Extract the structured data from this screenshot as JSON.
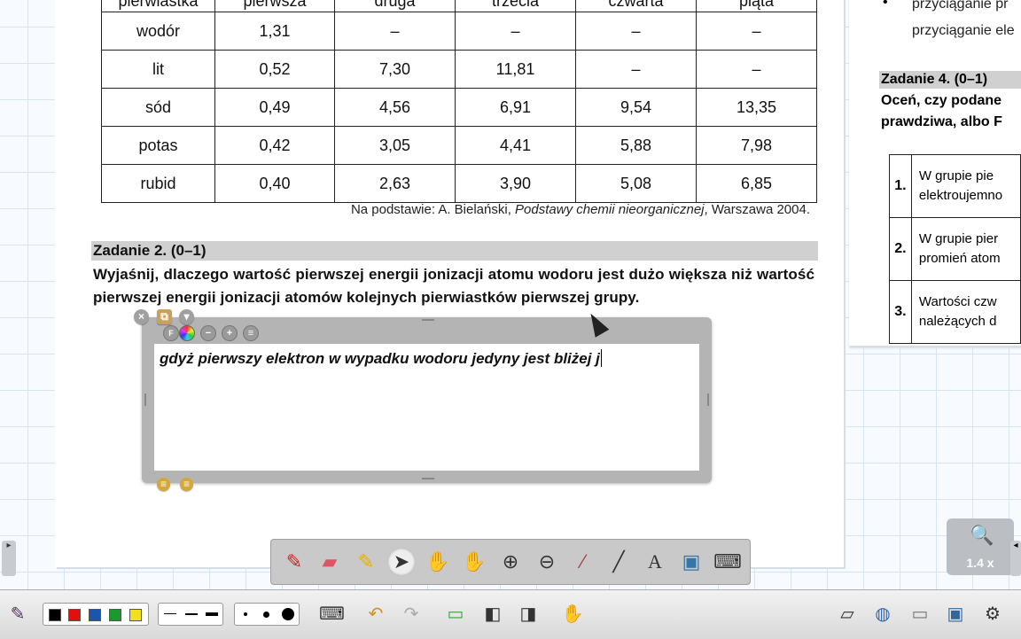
{
  "table": {
    "headers": [
      "pierwiastka",
      "pierwsza",
      "druga",
      "trzecia",
      "czwarta",
      "piąta"
    ],
    "rows": [
      [
        "wodór",
        "1,31",
        "–",
        "–",
        "–",
        "–"
      ],
      [
        "lit",
        "0,52",
        "7,30",
        "11,81",
        "–",
        "–"
      ],
      [
        "sód",
        "0,49",
        "4,56",
        "6,91",
        "9,54",
        "13,35"
      ],
      [
        "potas",
        "0,42",
        "3,05",
        "4,41",
        "5,88",
        "7,98"
      ],
      [
        "rubid",
        "0,40",
        "2,63",
        "3,90",
        "5,08",
        "6,85"
      ]
    ],
    "source_prefix": "Na podstawie: A. Bielański, ",
    "source_title": "Podstawy chemii nieorganicznej",
    "source_suffix": ", Warszawa 2004."
  },
  "task2": {
    "title": "Zadanie 2. (0–1)",
    "question": "Wyjaśnij, dlaczego wartość pierwszej energii jonizacji atomu wodoru jest dużo większa niż wartość pierwszej energii jonizacji atomów kolejnych pierwiastków pierwszej grupy."
  },
  "textbox": {
    "content": "gdyż pierwszy elektron w wypadku wodoru jedyny jest bliżej j",
    "icons": [
      "close-icon",
      "clone-icon",
      "menu-dropdown-icon",
      "font-icon",
      "color-icon",
      "decrease-icon",
      "increase-icon",
      "format-icon"
    ]
  },
  "right_page": {
    "bullet": "•",
    "line1": "przyciąganie pr",
    "line2": "przyciąganie ele",
    "task4_title": "Zadanie 4. (0–1)",
    "bold1": "Oceń, czy podane",
    "bold2": "prawdziwa, albo F",
    "rows": [
      {
        "num": "1.",
        "l1": "W grupie pie",
        "l2": "elektroujemno"
      },
      {
        "num": "2.",
        "l1": "W grupie pier",
        "l2": "promień atom"
      },
      {
        "num": "3.",
        "l1": "Wartości czw",
        "l2": "należących d"
      }
    ]
  },
  "float_toolbar": {
    "tools": [
      "pen-icon",
      "eraser-icon",
      "highlighter-icon",
      "select-arrow-icon",
      "magic-pen-icon",
      "hand-pan-icon",
      "zoom-in-icon",
      "zoom-out-icon",
      "screen-shade-icon",
      "line-icon",
      "text-icon",
      "capture-icon",
      "keyboard-icon"
    ],
    "active": "select-arrow-icon"
  },
  "zoom": {
    "label": "1.4 x"
  },
  "colors": {
    "swatches": [
      "#000000",
      "#e01010",
      "#1a56b0",
      "#1a9a2a",
      "#f0e020"
    ],
    "accent": "#d0d0d0"
  }
}
